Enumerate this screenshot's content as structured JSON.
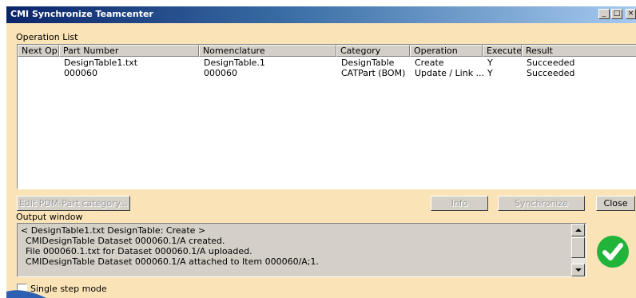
{
  "window": {
    "title": "CMI Synchronize Teamcenter",
    "minimize_glyph": "_",
    "maximize_glyph": "□",
    "close_glyph": "×"
  },
  "operation_list": {
    "label": "Operation List",
    "columns": [
      "Next Op",
      "Part Number",
      "Nomenclature",
      "Category",
      "Operation",
      "Execute",
      "Result"
    ],
    "rows": [
      {
        "next_op": "",
        "part_number": "DesignTable1.txt",
        "nomenclature": "DesignTable.1",
        "category": "DesignTable",
        "operation": "Create",
        "execute": "Y",
        "result": "Succeeded"
      },
      {
        "next_op": "",
        "part_number": "000060",
        "nomenclature": "000060",
        "category": "CATPart (BOM)",
        "operation": "Update / Link ...",
        "execute": "Y",
        "result": "Succeeded"
      }
    ]
  },
  "buttons": {
    "edit_category": "Edit PDM-Part category...",
    "info": "Info",
    "synchronize": "Synchronize",
    "close": "Close"
  },
  "output_window": {
    "label": "Output window",
    "lines": [
      "< DesignTable1.txt DesignTable: Create >",
      "CMIDesignTable Dataset 000060.1/A created.",
      "File 000060.1.txt for Dataset 000060.1/A uploaded.",
      "CMIDesignTable Dataset 000060.1/A attached to Item 000060/A;1."
    ]
  },
  "status_icon": "checkmark-success-icon",
  "single_step": {
    "label": "Single step mode",
    "checked": false
  },
  "colors": {
    "window_bg": "#fbe3b8",
    "title_start": "#0a246a",
    "title_end": "#a6caf0",
    "success_green": "#21b43a"
  }
}
